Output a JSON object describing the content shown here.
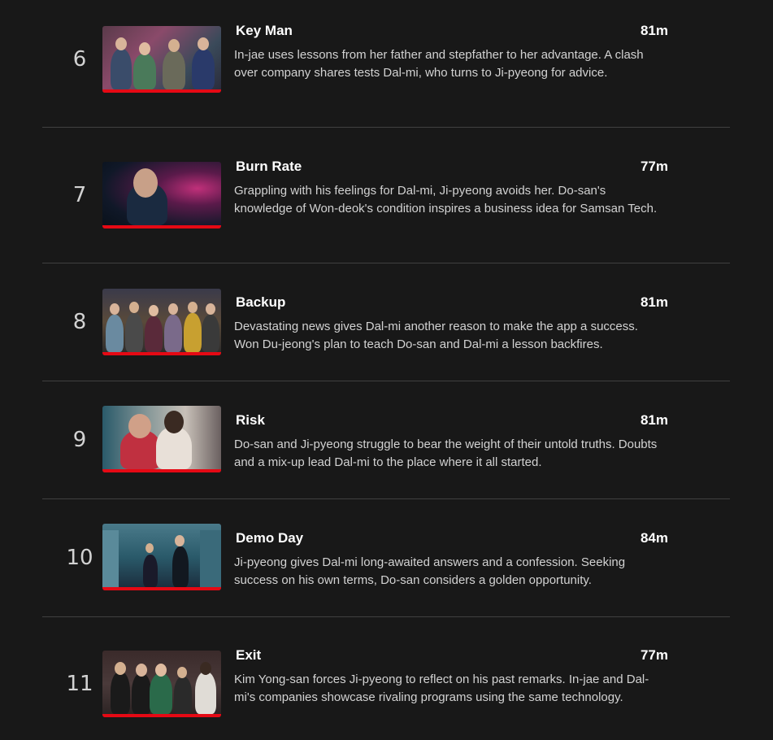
{
  "episodes": [
    {
      "number": "6",
      "title": "Key Man",
      "duration": "81m",
      "description": "In-jae uses lessons from her father and stepfather to her advantage. A clash over company shares tests Dal-mi, who turns to Ji-pyeong for advice.",
      "progress": 1.0
    },
    {
      "number": "7",
      "title": "Burn Rate",
      "duration": "77m",
      "description": "Grappling with his feelings for Dal-mi, Ji-pyeong avoids her. Do-san's knowledge of Won-deok's condition inspires a business idea for Samsan Tech.",
      "progress": 1.0
    },
    {
      "number": "8",
      "title": "Backup",
      "duration": "81m",
      "description": "Devastating news gives Dal-mi another reason to make the app a success. Won Du-jeong's plan to teach Do-san and Dal-mi a lesson backfires.",
      "progress": 1.0
    },
    {
      "number": "9",
      "title": "Risk",
      "duration": "81m",
      "description": "Do-san and Ji-pyeong struggle to bear the weight of their untold truths. Doubts and a mix-up lead Dal-mi to the place where it all started.",
      "progress": 1.0
    },
    {
      "number": "10",
      "title": "Demo Day",
      "duration": "84m",
      "description": "Ji-pyeong gives Dal-mi long-awaited answers and a confession. Seeking success on his own terms, Do-san considers a golden opportunity.",
      "progress": 1.0
    },
    {
      "number": "11",
      "title": "Exit",
      "duration": "77m",
      "description": "Kim Yong-san forces Ji-pyeong to reflect on his past remarks. In-jae and Dal-mi's companies showcase rivaling programs using the same technology.",
      "progress": 1.0
    }
  ],
  "colors": {
    "background": "#181818",
    "progress": "#e50914",
    "divider": "#404040",
    "text_secondary": "#d2d2d2"
  }
}
